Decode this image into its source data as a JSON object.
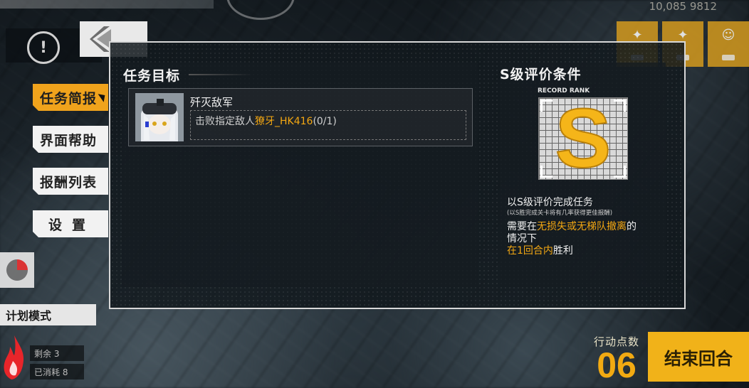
{
  "hud": {
    "top_resources": "10,085  9812",
    "info_icon": "!",
    "mode_label": "计划模式",
    "stats": [
      {
        "label": "剩余 3"
      },
      {
        "label": "已消耗 8"
      }
    ],
    "action_points_label": "行动点数",
    "action_points_value": "06",
    "end_turn_label": "结束回合"
  },
  "menu": {
    "items": [
      {
        "label": "任务简报",
        "active": true
      },
      {
        "label": "界面帮助",
        "active": false
      },
      {
        "label": "报酬列表",
        "active": false
      },
      {
        "label": "设置",
        "active": false
      }
    ]
  },
  "dialog": {
    "objectives_title": "任务目标",
    "objective": {
      "name": "歼灭敌军",
      "detail_prefix": "击败指定敌人",
      "target": "獠牙_HK416",
      "progress": "(0/1)"
    },
    "rank_title": "S级评价条件",
    "record_rank_label": "RECORD RANK",
    "rank_letter": "S",
    "condition_title": "以S级评价完成任务",
    "condition_note": "(以S胜完成关卡将有几率获得更佳报酬)",
    "condition_line1_prefix": "需要在",
    "condition_line1_highlight": "无损失或无梯队撤离",
    "condition_line1_suffix": "的",
    "condition_line2": "情况下",
    "condition_line3_highlight": "在1回合内",
    "condition_line3_suffix": "胜利"
  },
  "colors": {
    "accent": "#f0a31c",
    "highlight": "#f3a712",
    "panel": "#12181d"
  }
}
